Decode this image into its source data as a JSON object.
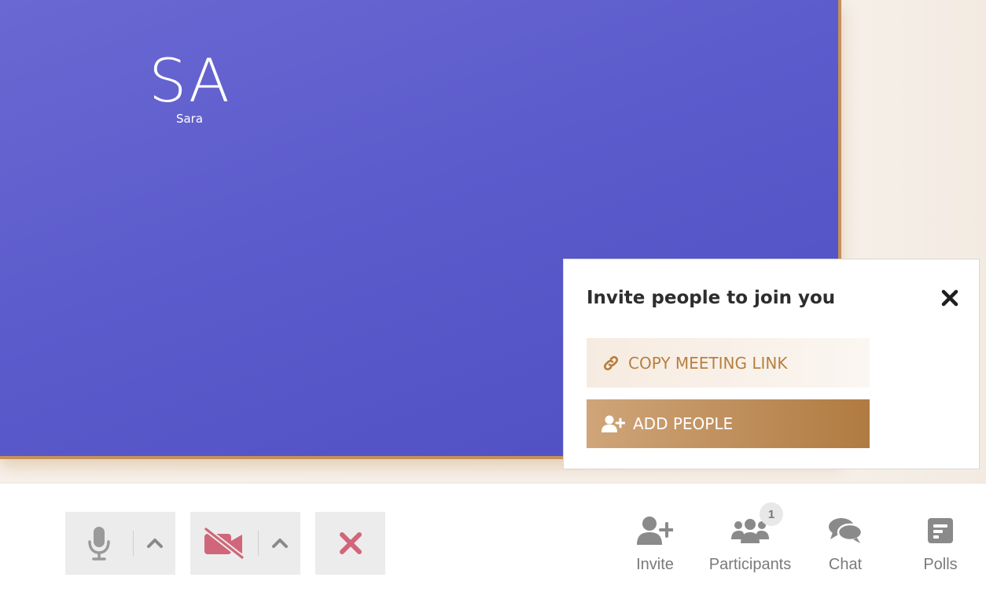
{
  "participant": {
    "initials": "SA",
    "name": "Sara"
  },
  "invite_popup": {
    "title": "Invite people to join you",
    "copy_link_label": "COPY MEETING LINK",
    "add_people_label": "ADD PEOPLE"
  },
  "toolbar": {
    "invite_label": "Invite",
    "participants_label": "Participants",
    "participants_count": "1",
    "chat_label": "Chat",
    "polls_label": "Polls"
  },
  "icons": {
    "microphone": "microphone-icon",
    "video_off": "video-off-icon",
    "leave": "close-icon",
    "invite": "user-plus-icon",
    "participants": "users-icon",
    "chat": "comments-icon",
    "polls": "poll-icon",
    "link": "link-icon"
  },
  "colors": {
    "accent": "#b6803f",
    "tile": "#5c5bcc",
    "danger": "#d0667a"
  }
}
